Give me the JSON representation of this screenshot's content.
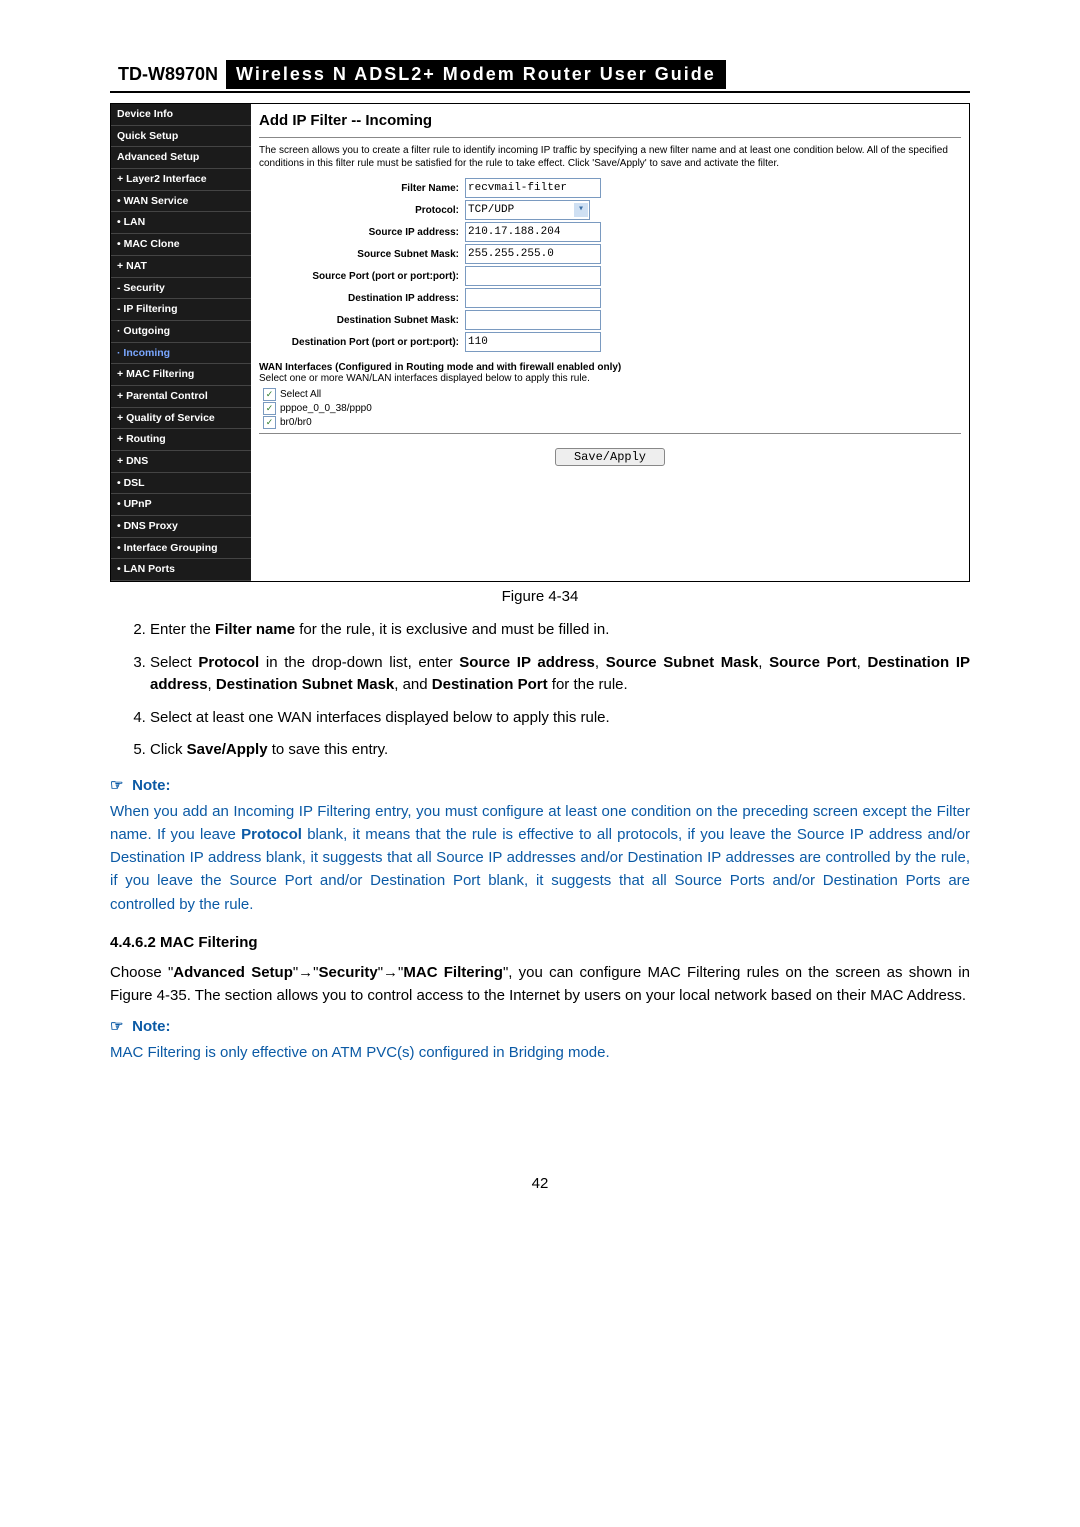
{
  "header": {
    "model": "TD-W8970N",
    "title": "Wireless N ADSL2+ Modem Router User Guide"
  },
  "nav": {
    "items": [
      {
        "label": "Device Info",
        "cls": ""
      },
      {
        "label": "Quick Setup",
        "cls": ""
      },
      {
        "label": "Advanced Setup",
        "cls": ""
      },
      {
        "label": "Layer2 Interface",
        "cls": "plus"
      },
      {
        "label": "WAN Service",
        "cls": "sub1"
      },
      {
        "label": "LAN",
        "cls": "sub1"
      },
      {
        "label": "MAC Clone",
        "cls": "sub1"
      },
      {
        "label": "NAT",
        "cls": "plus"
      },
      {
        "label": "Security",
        "cls": "minus"
      },
      {
        "label": "IP Filtering",
        "cls": "minus"
      },
      {
        "label": "Outgoing",
        "cls": "dot"
      },
      {
        "label": "Incoming",
        "cls": "dot active"
      },
      {
        "label": "MAC Filtering",
        "cls": "plus"
      },
      {
        "label": "Parental Control",
        "cls": "plus"
      },
      {
        "label": "Quality of Service",
        "cls": "plus"
      },
      {
        "label": "Routing",
        "cls": "plus"
      },
      {
        "label": "DNS",
        "cls": "plus"
      },
      {
        "label": "DSL",
        "cls": "sub1"
      },
      {
        "label": "UPnP",
        "cls": "sub1"
      },
      {
        "label": "DNS Proxy",
        "cls": "sub1"
      },
      {
        "label": "Interface Grouping",
        "cls": "sub1"
      },
      {
        "label": "LAN Ports",
        "cls": "sub1"
      }
    ]
  },
  "form": {
    "heading": "Add IP Filter -- Incoming",
    "desc": "The screen allows you to create a filter rule to identify incoming IP traffic by specifying a new filter name and at least one condition below. All of the specified conditions in this filter rule must be satisfied for the rule to take effect. Click 'Save/Apply' to save and activate the filter.",
    "labels": {
      "filter_name": "Filter Name:",
      "protocol": "Protocol:",
      "src_ip": "Source IP address:",
      "src_mask": "Source Subnet Mask:",
      "src_port": "Source Port (port or port:port):",
      "dst_ip": "Destination IP address:",
      "dst_mask": "Destination Subnet Mask:",
      "dst_port": "Destination Port (port or port:port):"
    },
    "values": {
      "filter_name": "recvmail-filter",
      "protocol": "TCP/UDP",
      "src_ip": "210.17.188.204",
      "src_mask": "255.255.255.0",
      "src_port": "",
      "dst_ip": "",
      "dst_mask": "",
      "dst_port": "110"
    },
    "wan_title": "WAN Interfaces (Configured in Routing mode and with firewall enabled only)",
    "wan_desc": "Select one or more WAN/LAN interfaces displayed below to apply this rule.",
    "checkboxes": [
      {
        "label": "Select All",
        "checked": true
      },
      {
        "label": "pppoe_0_0_38/ppp0",
        "checked": true
      },
      {
        "label": "br0/br0",
        "checked": true
      }
    ],
    "save_label": "Save/Apply"
  },
  "figure_label": "Figure 4-34",
  "steps": {
    "2": {
      "pre": "Enter the ",
      "b1": "Filter name",
      "post": " for the rule, it is exclusive and must be filled in."
    },
    "3": {
      "pre": "Select ",
      "b1": "Protocol",
      "mid1": " in the drop-down list, enter ",
      "b2": "Source IP address",
      "sep1": ", ",
      "b3": "Source Subnet Mask",
      "sep2": ", ",
      "b4": "Source Port",
      "sep3": ", ",
      "b5": "Destination IP address",
      "sep4": ", ",
      "b6": "Destination Subnet Mask",
      "sep5": ", and ",
      "b7": "Destination Port",
      "post": " for the rule."
    },
    "4": "Select at least one WAN interfaces displayed below to apply this rule.",
    "5": {
      "pre": "Click ",
      "b1": "Save/Apply",
      "post": " to save this entry."
    }
  },
  "note1": {
    "head": "Note:",
    "body_pre": "When you add an Incoming IP Filtering entry, you must configure at least one condition on the preceding screen except the Filter name. If you leave ",
    "b1": "Protocol",
    "body_post": " blank, it means that the rule is effective to all protocols, if you leave the Source IP address and/or Destination IP address blank, it suggests that all Source IP addresses and/or Destination IP addresses are controlled by the rule, if you leave the Source Port and/or Destination Port blank, it suggests that all Source Ports and/or Destination Ports are controlled by the rule."
  },
  "section": {
    "num_head": "4.4.6.2   MAC Filtering",
    "p_pre": "Choose \"",
    "b1": "Advanced Setup",
    "arr": "\"→\"",
    "b2": "Security",
    "arr2": "\"→\"",
    "b3": "MAC Filtering",
    "p_post": "\", you can configure MAC Filtering rules on the screen as shown in Figure 4-35. The section allows you to control access to the Internet by users on your local network based on their MAC Address."
  },
  "note2": {
    "head": "Note:",
    "body": "MAC Filtering is only effective on ATM PVC(s) configured in Bridging mode."
  },
  "page_number": "42"
}
